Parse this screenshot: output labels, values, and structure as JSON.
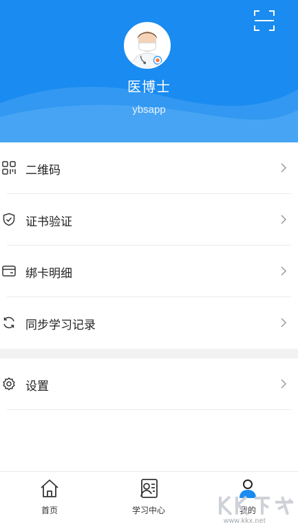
{
  "profile": {
    "name": "医博士",
    "account": "ybsapp"
  },
  "menu": {
    "items": [
      {
        "label": "二维码",
        "icon": "qr-code-icon"
      },
      {
        "label": "证书验证",
        "icon": "shield-check-icon"
      },
      {
        "label": "绑卡明细",
        "icon": "card-icon"
      },
      {
        "label": "同步学习记录",
        "icon": "sync-icon"
      }
    ],
    "settings": {
      "label": "设置",
      "icon": "gear-icon"
    }
  },
  "tabbar": {
    "tabs": [
      {
        "label": "首页",
        "icon": "home-icon"
      },
      {
        "label": "学习中心",
        "icon": "study-center-icon"
      },
      {
        "label": "我的",
        "icon": "profile-icon",
        "active": true
      }
    ]
  },
  "watermark": {
    "logo_text": "KK下载",
    "url": "www.kkx.net"
  },
  "colors": {
    "header_blue": "#1a8bf0",
    "active_tab": "#1a8bf0"
  }
}
